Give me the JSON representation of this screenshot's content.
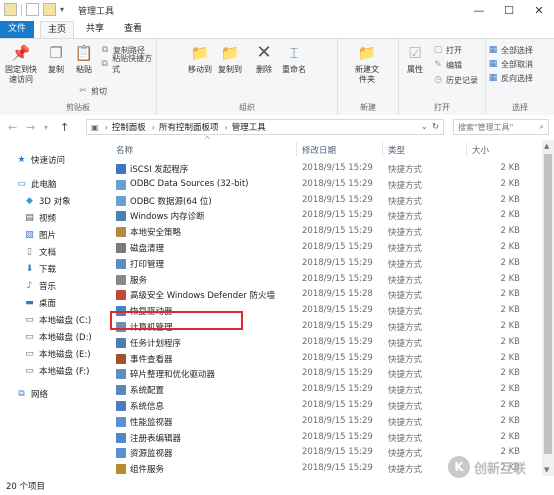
{
  "window": {
    "title": "管理工具",
    "min": "—",
    "max": "☐",
    "close": "✕"
  },
  "tabs": {
    "file": "文件",
    "home": "主页",
    "share": "共享",
    "view": "查看"
  },
  "ribbon": {
    "pin": "固定到快速访问",
    "copy": "复制",
    "paste": "粘贴",
    "copy_path": "复制路径",
    "paste_shortcut": "粘贴快捷方式",
    "cut": "剪切",
    "clipboard_group": "剪贴板",
    "move_to": "移动到",
    "copy_to": "复制到",
    "delete": "删除",
    "rename": "重命名",
    "organize_group": "组织",
    "new_folder": "新建文件夹",
    "new_group": "新建",
    "properties": "属性",
    "open": "打开",
    "edit": "编辑",
    "history": "历史记录",
    "open_group": "打开",
    "select_all": "全部选择",
    "select_none": "全部取消",
    "invert": "反向选择",
    "select_group": "选择"
  },
  "address": {
    "crumbs": [
      "控制面板",
      "所有控制面板项",
      "管理工具"
    ],
    "search_placeholder": "搜索\"管理工具\""
  },
  "nav": {
    "quick_access": "快速访问",
    "this_pc": "此电脑",
    "objects3d": "3D 对象",
    "videos": "视频",
    "pictures": "图片",
    "documents": "文档",
    "downloads": "下载",
    "music": "音乐",
    "desktop": "桌面",
    "disk_c": "本地磁盘 (C:)",
    "disk_d": "本地磁盘 (D:)",
    "disk_e": "本地磁盘 (E:)",
    "disk_f": "本地磁盘 (F:)",
    "network": "网络"
  },
  "columns": {
    "name": "名称",
    "date": "修改日期",
    "type": "类型",
    "size": "大小"
  },
  "files": [
    {
      "name": "iSCSI 发起程序",
      "date": "2018/9/15 15:29",
      "type": "快捷方式",
      "size": "2 KB",
      "color": "#3a78c4"
    },
    {
      "name": "ODBC Data Sources (32-bit)",
      "date": "2018/9/15 15:29",
      "type": "快捷方式",
      "size": "2 KB",
      "color": "#6a9fd8"
    },
    {
      "name": "ODBC 数据源(64 位)",
      "date": "2018/9/15 15:29",
      "type": "快捷方式",
      "size": "2 KB",
      "color": "#6a9fd8"
    },
    {
      "name": "Windows 内存诊断",
      "date": "2018/9/15 15:29",
      "type": "快捷方式",
      "size": "2 KB",
      "color": "#4a7fb8"
    },
    {
      "name": "本地安全策略",
      "date": "2018/9/15 15:29",
      "type": "快捷方式",
      "size": "2 KB",
      "color": "#b08a3e"
    },
    {
      "name": "磁盘清理",
      "date": "2018/9/15 15:29",
      "type": "快捷方式",
      "size": "2 KB",
      "color": "#7a7a7a"
    },
    {
      "name": "打印管理",
      "date": "2018/9/15 15:29",
      "type": "快捷方式",
      "size": "2 KB",
      "color": "#5d8fc4"
    },
    {
      "name": "服务",
      "date": "2018/9/15 15:29",
      "type": "快捷方式",
      "size": "2 KB",
      "color": "#8a8a8a"
    },
    {
      "name": "高级安全 Windows Defender 防火墙",
      "date": "2018/9/15 15:28",
      "type": "快捷方式",
      "size": "2 KB",
      "color": "#c2493a"
    },
    {
      "name": "恢复驱动器",
      "date": "2018/9/15 15:29",
      "type": "快捷方式",
      "size": "2 KB",
      "color": "#3f86c7"
    },
    {
      "name": "计算机管理",
      "date": "2018/9/15 15:29",
      "type": "快捷方式",
      "size": "2 KB",
      "color": "#6f8fb0"
    },
    {
      "name": "任务计划程序",
      "date": "2018/9/15 15:29",
      "type": "快捷方式",
      "size": "2 KB",
      "color": "#4d7fb5"
    },
    {
      "name": "事件查看器",
      "date": "2018/9/15 15:29",
      "type": "快捷方式",
      "size": "2 KB",
      "color": "#a0522d"
    },
    {
      "name": "碎片整理和优化驱动器",
      "date": "2018/9/15 15:29",
      "type": "快捷方式",
      "size": "2 KB",
      "color": "#5f8fbe"
    },
    {
      "name": "系统配置",
      "date": "2018/9/15 15:29",
      "type": "快捷方式",
      "size": "2 KB",
      "color": "#5a86b8"
    },
    {
      "name": "系统信息",
      "date": "2018/9/15 15:29",
      "type": "快捷方式",
      "size": "2 KB",
      "color": "#4b7cc0"
    },
    {
      "name": "性能监视器",
      "date": "2018/9/15 15:29",
      "type": "快捷方式",
      "size": "2 KB",
      "color": "#5b8fcf"
    },
    {
      "name": "注册表编辑器",
      "date": "2018/9/15 15:29",
      "type": "快捷方式",
      "size": "2 KB",
      "color": "#4a8ac8"
    },
    {
      "name": "资源监视器",
      "date": "2018/9/15 15:29",
      "type": "快捷方式",
      "size": "2 KB",
      "color": "#5b8fcf"
    },
    {
      "name": "组件服务",
      "date": "2018/9/15 15:29",
      "type": "快捷方式",
      "size": "2 KB",
      "color": "#b68a2e"
    }
  ],
  "status": {
    "count": "20 个项目"
  },
  "watermark": {
    "logo": "K",
    "text": "创新互联"
  }
}
